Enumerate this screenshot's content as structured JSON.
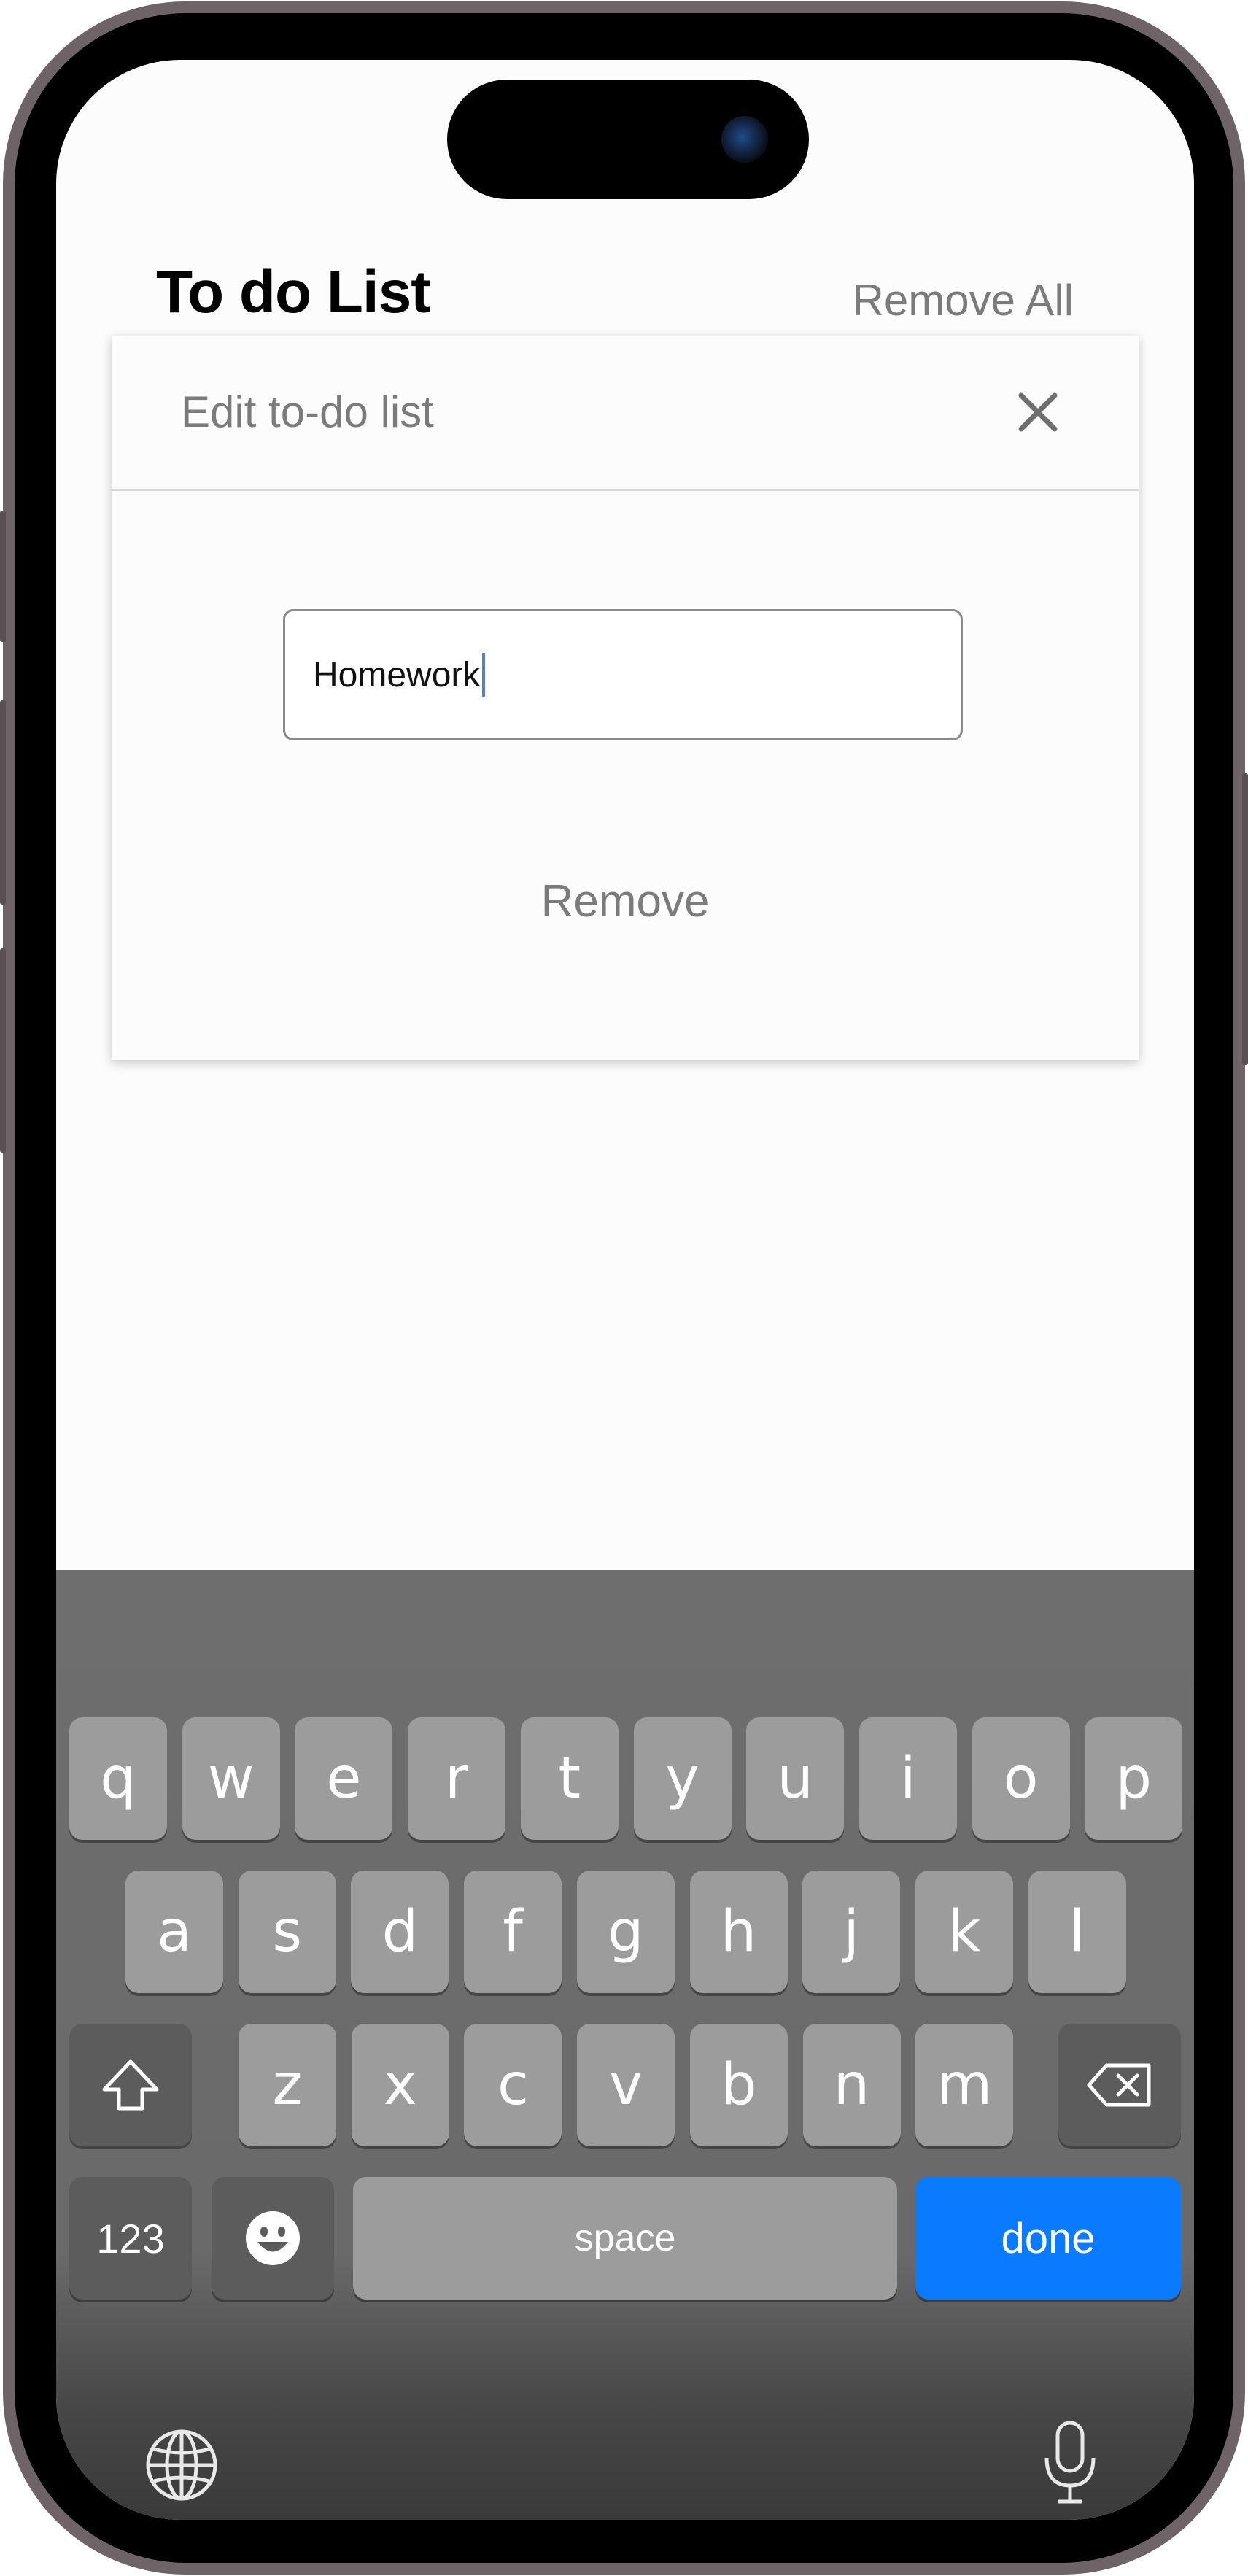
{
  "header": {
    "title": "To do List",
    "remove_all_label": "Remove All"
  },
  "modal": {
    "title": "Edit to-do list",
    "close_icon": "close-icon",
    "input_value": "Homework",
    "remove_label": "Remove"
  },
  "keyboard": {
    "row1": [
      "q",
      "w",
      "e",
      "r",
      "t",
      "y",
      "u",
      "i",
      "o",
      "p"
    ],
    "row2": [
      "a",
      "s",
      "d",
      "f",
      "g",
      "h",
      "j",
      "k",
      "l"
    ],
    "row3": [
      "z",
      "x",
      "c",
      "v",
      "b",
      "n",
      "m"
    ],
    "shift_icon": "shift-icon",
    "backspace_icon": "backspace-icon",
    "numbers_label": "123",
    "emoji_icon": "emoji-icon",
    "space_label": "space",
    "done_label": "done",
    "globe_icon": "globe-icon",
    "mic_icon": "microphone-icon"
  },
  "colors": {
    "accent": "#0a7aff",
    "key": "#9c9c9c",
    "key_dark": "#5c5c5c",
    "keyboard_bg": "#6e6e6e",
    "muted_text": "#7b7b7b"
  }
}
